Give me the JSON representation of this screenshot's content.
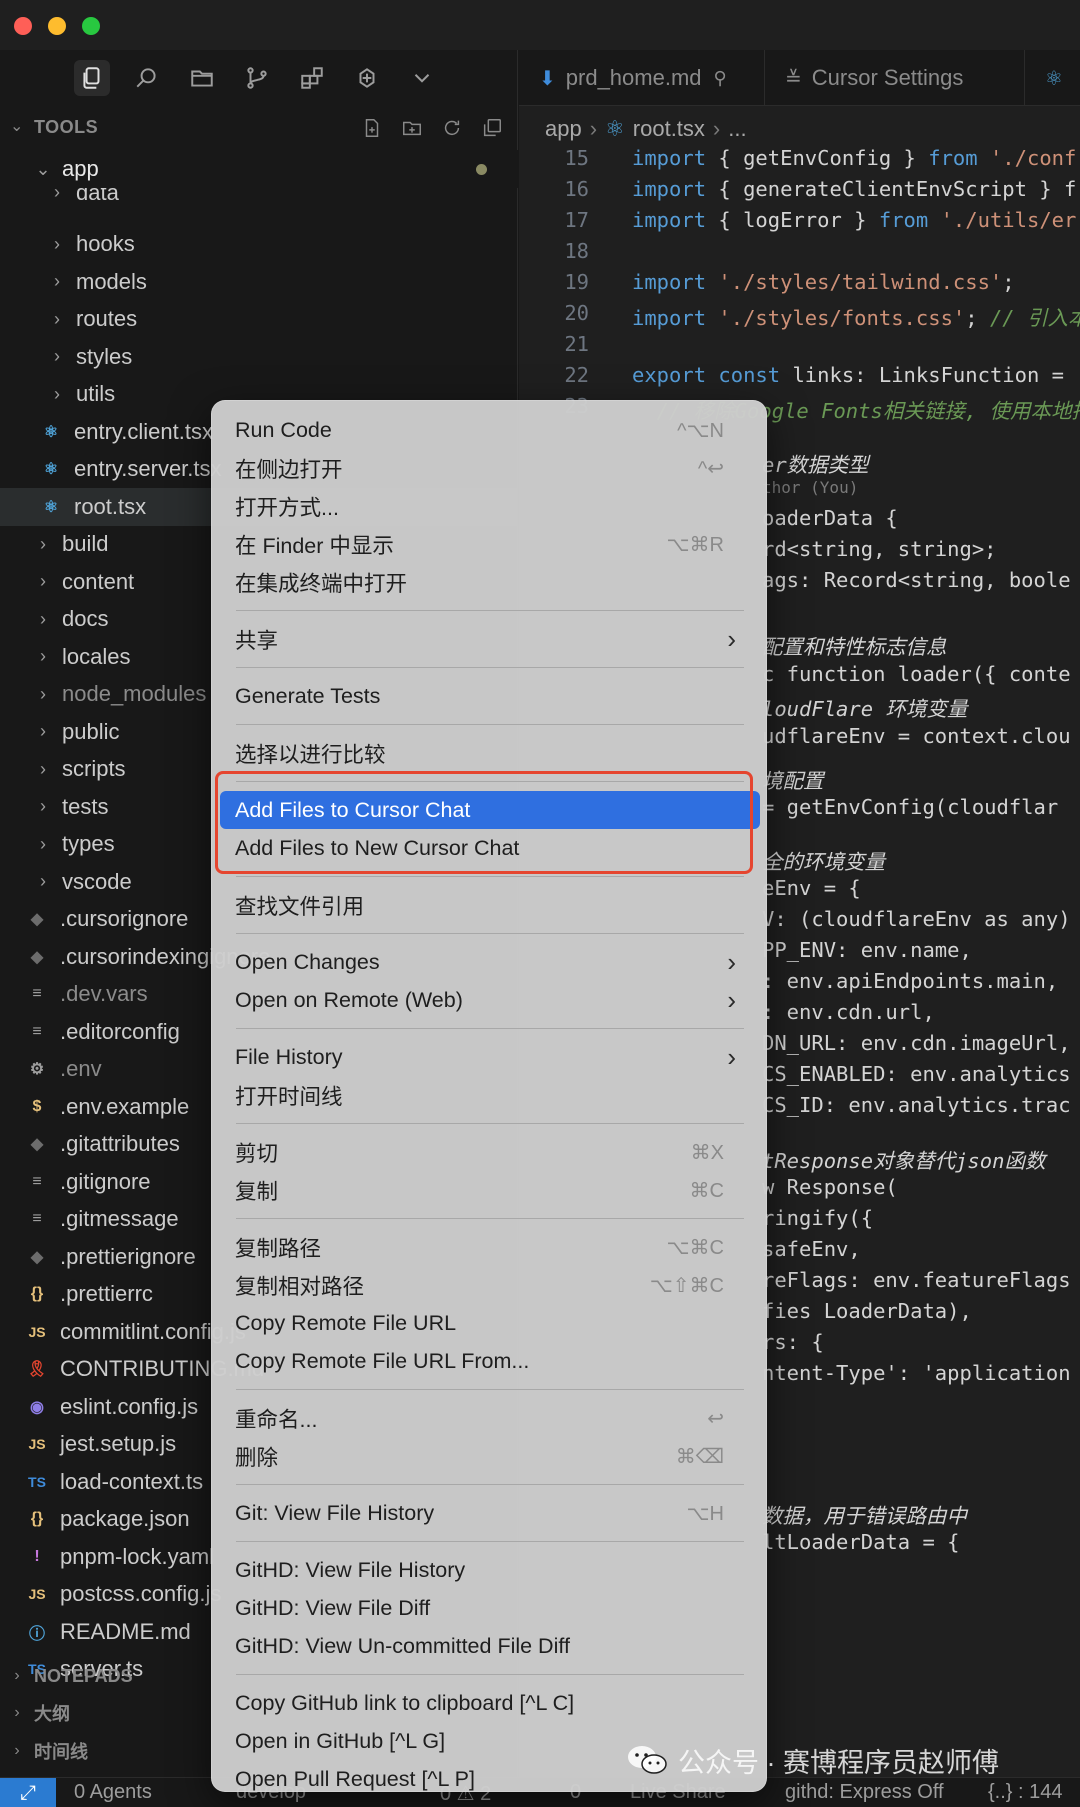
{
  "sidebar": {
    "section_title": "TOOLS",
    "tree": [
      {
        "label": "app",
        "kind": "folder-open",
        "indent": 0
      },
      {
        "label": "data",
        "kind": "folder",
        "indent": 1
      },
      {
        "label": "hooks",
        "kind": "folder",
        "indent": 1
      },
      {
        "label": "models",
        "kind": "folder",
        "indent": 1
      },
      {
        "label": "routes",
        "kind": "folder",
        "indent": 1
      },
      {
        "label": "styles",
        "kind": "folder",
        "indent": 1
      },
      {
        "label": "utils",
        "kind": "folder",
        "indent": 1
      },
      {
        "label": "entry.client.tsx",
        "kind": "react",
        "indent": 1
      },
      {
        "label": "entry.server.tsx",
        "kind": "react",
        "indent": 1
      },
      {
        "label": "root.tsx",
        "kind": "react",
        "indent": 1,
        "selected": true
      },
      {
        "label": "build",
        "kind": "folder",
        "indent": 0
      },
      {
        "label": "content",
        "kind": "folder",
        "indent": 0
      },
      {
        "label": "docs",
        "kind": "folder",
        "indent": 0
      },
      {
        "label": "locales",
        "kind": "folder",
        "indent": 0
      },
      {
        "label": "node_modules",
        "kind": "folder",
        "indent": 0,
        "muted": true
      },
      {
        "label": "public",
        "kind": "folder",
        "indent": 0
      },
      {
        "label": "scripts",
        "kind": "folder",
        "indent": 0
      },
      {
        "label": "tests",
        "kind": "folder",
        "indent": 0
      },
      {
        "label": "types",
        "kind": "folder",
        "indent": 0
      },
      {
        "label": "vscode",
        "kind": "folder",
        "indent": 0
      },
      {
        "label": ".cursorignore",
        "kind": "diamond",
        "indent": 0
      },
      {
        "label": ".cursorindexingignore",
        "kind": "diamond",
        "indent": 0
      },
      {
        "label": ".dev.vars",
        "kind": "lines",
        "indent": 0,
        "muted": true
      },
      {
        "label": ".editorconfig",
        "kind": "lines",
        "indent": 0
      },
      {
        "label": ".env",
        "kind": "gear",
        "indent": 0,
        "muted": true
      },
      {
        "label": ".env.example",
        "kind": "dollar",
        "indent": 0
      },
      {
        "label": ".gitattributes",
        "kind": "diamond",
        "indent": 0
      },
      {
        "label": ".gitignore",
        "kind": "lines",
        "indent": 0
      },
      {
        "label": ".gitmessage",
        "kind": "lines",
        "indent": 0
      },
      {
        "label": ".prettierignore",
        "kind": "diamond",
        "indent": 0
      },
      {
        "label": ".prettierrc",
        "kind": "braces",
        "indent": 0
      },
      {
        "label": "commitlint.config.js",
        "kind": "js",
        "indent": 0
      },
      {
        "label": "CONTRIBUTING.md",
        "kind": "ribbon",
        "indent": 0
      },
      {
        "label": "eslint.config.js",
        "kind": "eslint",
        "indent": 0
      },
      {
        "label": "jest.setup.js",
        "kind": "js",
        "indent": 0
      },
      {
        "label": "load-context.ts",
        "kind": "ts",
        "indent": 0
      },
      {
        "label": "package.json",
        "kind": "braces",
        "indent": 0
      },
      {
        "label": "pnpm-lock.yaml",
        "kind": "bang",
        "indent": 0
      },
      {
        "label": "postcss.config.js",
        "kind": "js",
        "indent": 0
      },
      {
        "label": "README.md",
        "kind": "info",
        "indent": 0
      },
      {
        "label": "server.ts",
        "kind": "ts",
        "indent": 0
      }
    ],
    "notepads": "NOTEPADS",
    "outline": "大纲",
    "timeline": "时间线"
  },
  "editor": {
    "tabs": [
      {
        "label": "prd_home.md",
        "icon": "markdown-icon"
      },
      {
        "label": "Cursor Settings",
        "icon": "settings-sliders-icon"
      }
    ],
    "breadcrumb": [
      "app",
      "root.tsx",
      "..."
    ],
    "line_numbers": [
      "15",
      "16",
      "17",
      "18",
      "19",
      "20",
      "21",
      "22",
      "23"
    ],
    "code": [
      "import { getEnvConfig } from './conf",
      "import { generateClientEnvScript } f",
      "import { logError } from './utils/er",
      "",
      "import './styles/tailwind.css';",
      "import './styles/fonts.css'; // 引入本",
      "",
      "export const links: LinksFunction = ",
      "  // 移除Google Fonts相关链接, 使用本地持"
    ],
    "visible_fragments": [
      "er数据类型",
      "thor (You)",
      "oaderData {",
      "rd<string, string>;",
      "ags: Record<string, boole",
      "配置和特性标志信息",
      "c function loader({ conte",
      "loudFlare 环境变量",
      "udflareEnv = context.clou",
      "境配置",
      "= getEnvConfig(cloudflar",
      "全的环境变量",
      "eEnv = {",
      "V: (cloudflareEnv as any)",
      "PP_ENV: env.name,",
      ": env.apiEndpoints.main,",
      ": env.cdn.url,",
      "DN_URL: env.cdn.imageUrl,",
      "CS_ENABLED: env.analytics",
      "CS_ID: env.analytics.trac",
      "tResponse对象替代json函数",
      "w Response(",
      "ringify({",
      "safeEnv,",
      "reFlags: env.featureFlags",
      "fies LoaderData),",
      "rs: {",
      "ntent-Type': 'application",
      "数据，用于错误路由中",
      "ltLoaderData = {"
    ]
  },
  "context_menu": {
    "groups": [
      [
        {
          "label": "Run Code",
          "shortcut": "^⌥N"
        },
        {
          "label": "在侧边打开",
          "shortcut": "^↩"
        },
        {
          "label": "打开方式...",
          "shortcut": ""
        },
        {
          "label": "在 Finder 中显示",
          "shortcut": "⌥⌘R"
        },
        {
          "label": "在集成终端中打开",
          "shortcut": ""
        }
      ],
      [
        {
          "label": "共享",
          "submenu": true
        }
      ],
      [
        {
          "label": "Generate Tests"
        }
      ],
      [
        {
          "label": "选择以进行比较"
        }
      ],
      [
        {
          "label": "Add Files to Cursor Chat",
          "highlighted": true
        },
        {
          "label": "Add Files to New Cursor Chat"
        }
      ],
      [
        {
          "label": "查找文件引用"
        }
      ],
      [
        {
          "label": "Open Changes",
          "submenu": true
        },
        {
          "label": "Open on Remote (Web)",
          "submenu": true
        }
      ],
      [
        {
          "label": "File History",
          "submenu": true
        },
        {
          "label": "打开时间线"
        }
      ],
      [
        {
          "label": "剪切",
          "shortcut": "⌘X"
        },
        {
          "label": "复制",
          "shortcut": "⌘C"
        }
      ],
      [
        {
          "label": "复制路径",
          "shortcut": "⌥⌘C"
        },
        {
          "label": "复制相对路径",
          "shortcut": "⌥⇧⌘C"
        },
        {
          "label": "Copy Remote File URL"
        },
        {
          "label": "Copy Remote File URL From..."
        }
      ],
      [
        {
          "label": "重命名...",
          "shortcut": "↩"
        },
        {
          "label": "删除",
          "shortcut": "⌘⌫"
        }
      ],
      [
        {
          "label": "Git: View File History",
          "shortcut": "⌥H"
        }
      ],
      [
        {
          "label": "GitHD: View File History"
        },
        {
          "label": "GitHD: View File Diff"
        },
        {
          "label": "GitHD: View Un-committed File Diff"
        }
      ],
      [
        {
          "label": "Copy GitHub link to clipboard [^L C]"
        },
        {
          "label": "Open in GitHub [^L G]"
        },
        {
          "label": "Open Pull Request [^L P]"
        }
      ]
    ]
  },
  "statusbar": {
    "remote_icon": "remote-icon",
    "agents": "0 Agents",
    "branch": "develop",
    "problems": "0 ⚠ 2",
    "ports": "0",
    "live_share": "Live Share",
    "githd": "githd: Express Off",
    "braces": "{..} : 144"
  },
  "watermark": {
    "text": "公众号 · 赛博程序员赵师傅"
  },
  "colors": {
    "menu_highlight": "#2f6fe0",
    "annotation_box": "#e5452f"
  }
}
